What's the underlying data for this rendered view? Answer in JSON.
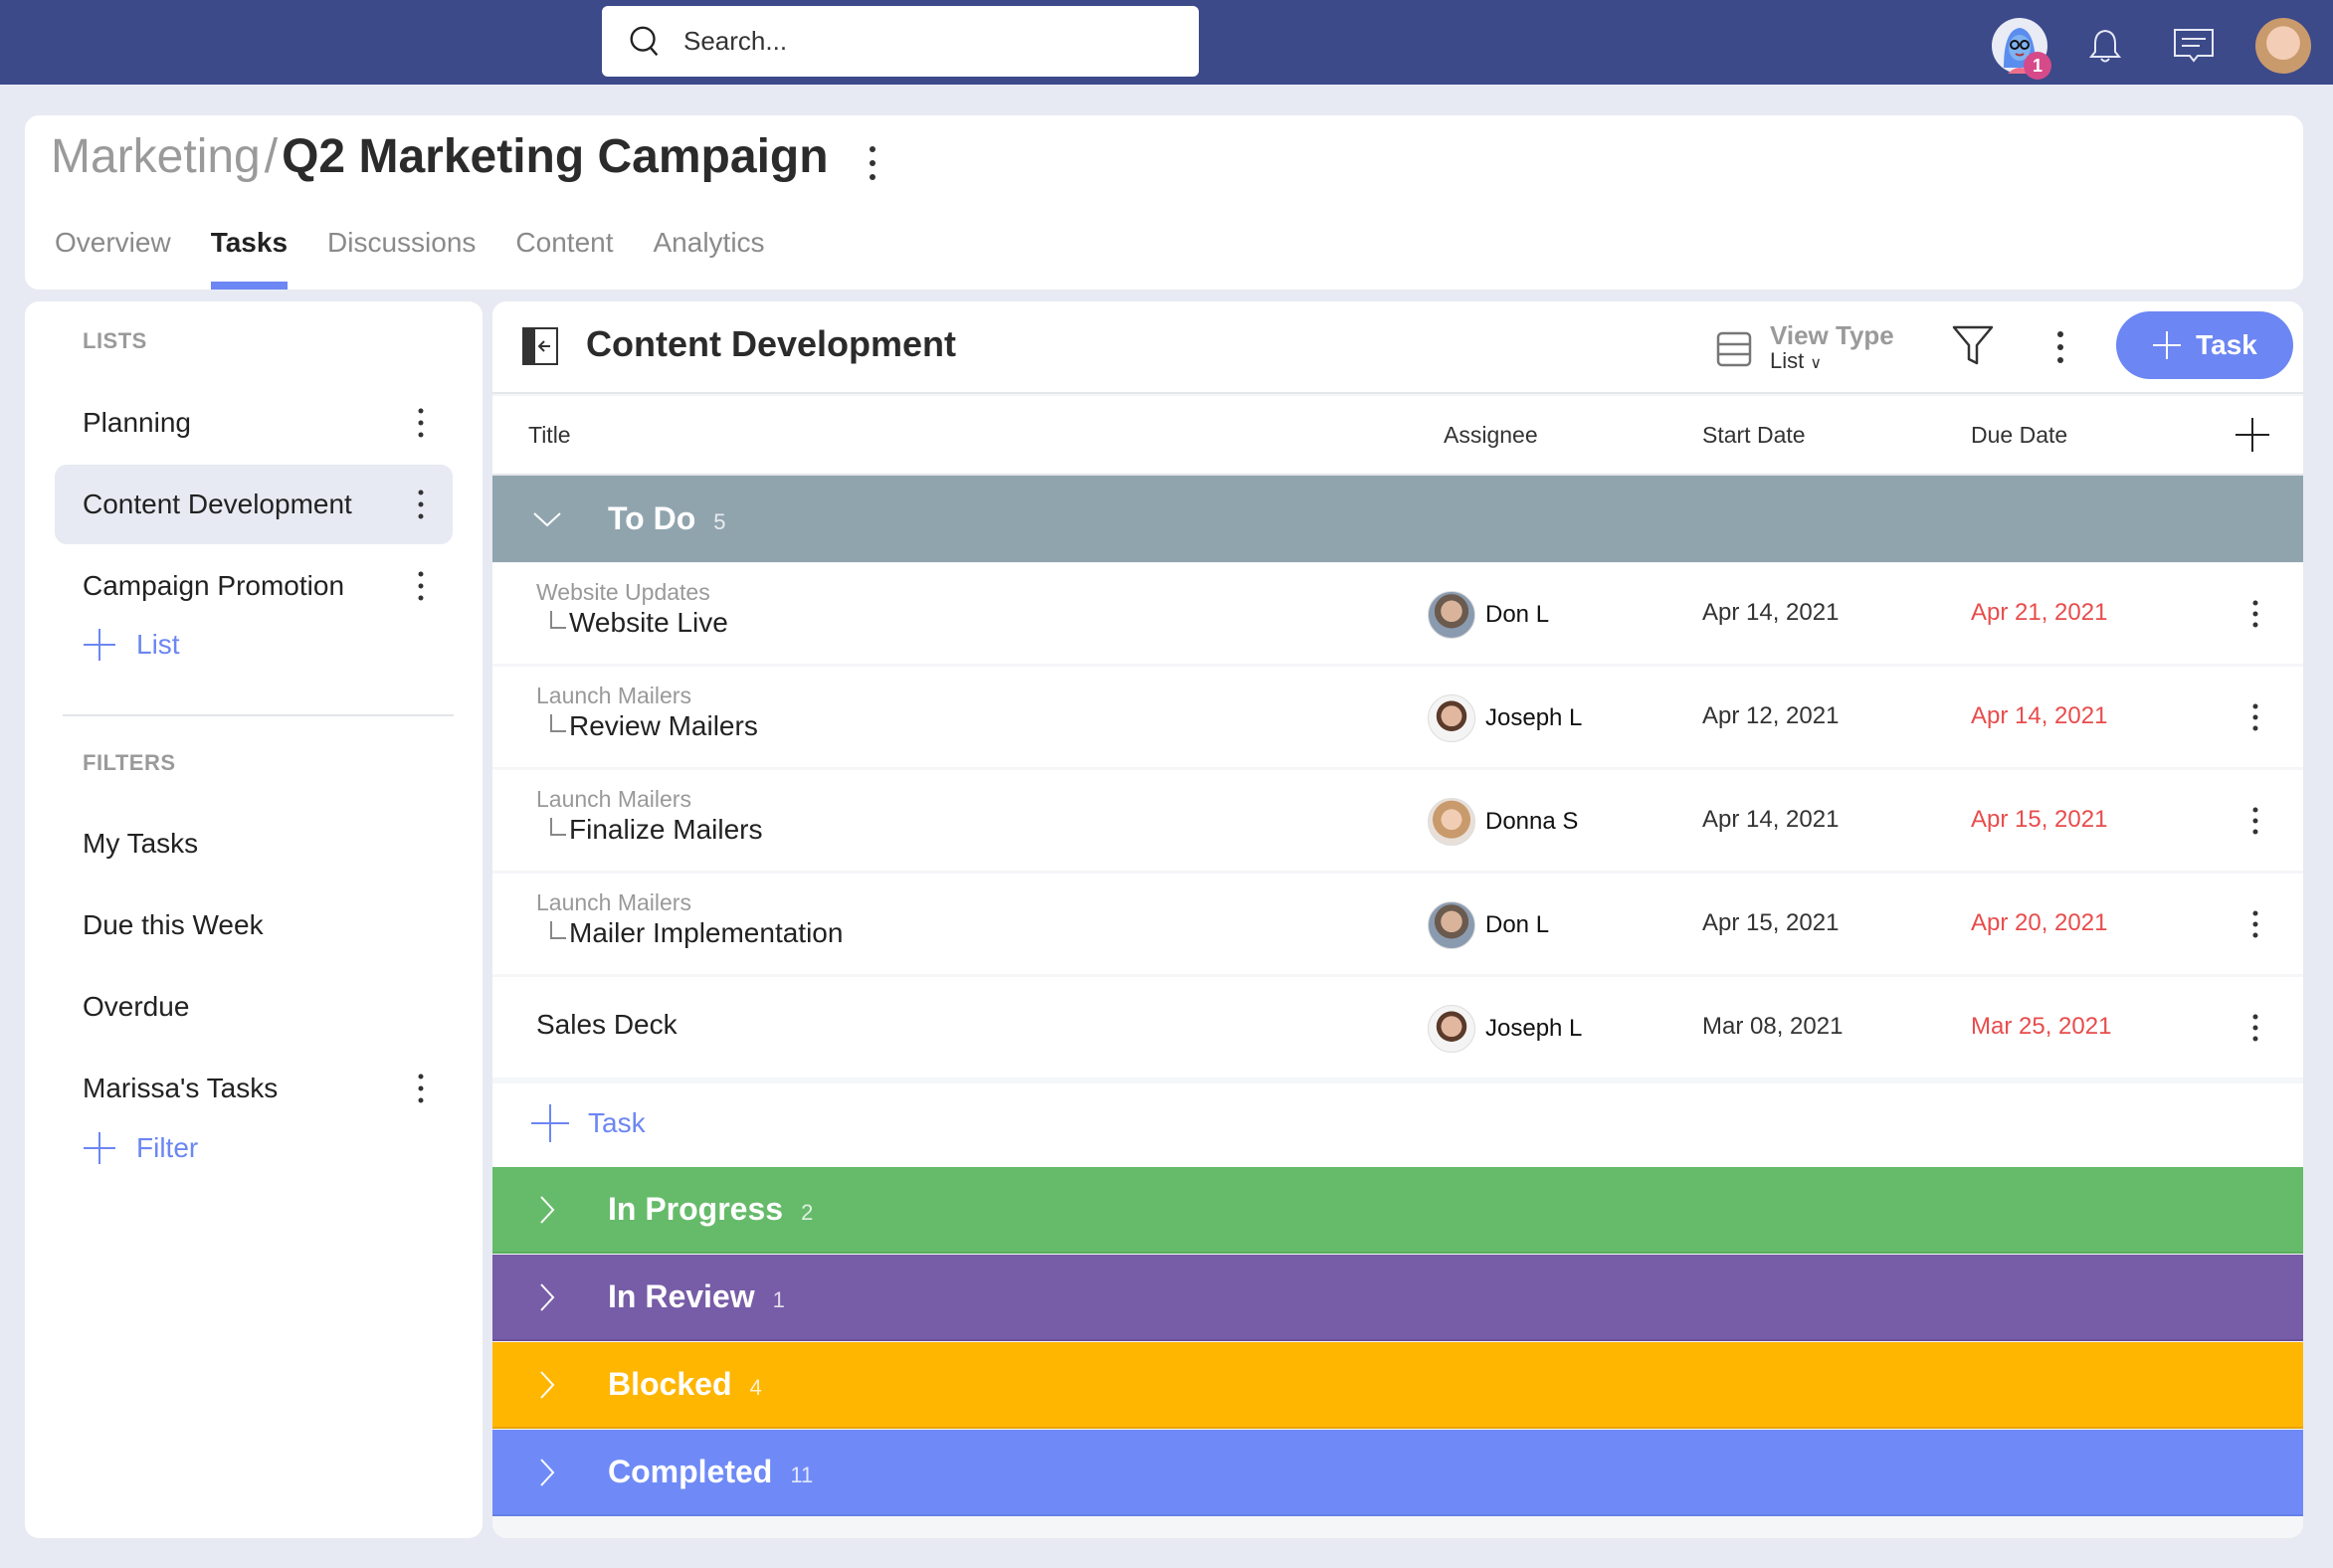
{
  "topbar": {
    "search_placeholder": "Search...",
    "notification_badge": "1",
    "icons": [
      "search-icon",
      "assistant-avatar",
      "bell-icon",
      "chat-icon",
      "user-avatar"
    ]
  },
  "header": {
    "breadcrumb_parent": "Marketing",
    "breadcrumb_separator": "/",
    "title": "Q2 Marketing Campaign",
    "tabs": [
      {
        "label": "Overview",
        "active": false
      },
      {
        "label": "Tasks",
        "active": true
      },
      {
        "label": "Discussions",
        "active": false
      },
      {
        "label": "Content",
        "active": false
      },
      {
        "label": "Analytics",
        "active": false
      }
    ]
  },
  "sidebar": {
    "lists_heading": "LISTS",
    "lists": [
      {
        "label": "Planning",
        "active": false
      },
      {
        "label": "Content Development",
        "active": true
      },
      {
        "label": "Campaign Promotion",
        "active": false
      }
    ],
    "add_list_label": "List",
    "filters_heading": "FILTERS",
    "filters": [
      {
        "label": "My Tasks"
      },
      {
        "label": "Due this Week"
      },
      {
        "label": "Overdue"
      },
      {
        "label": "Marissa's Tasks"
      }
    ],
    "add_filter_label": "Filter"
  },
  "main": {
    "list_title": "Content Development",
    "view_type_label": "View Type",
    "view_type_value": "List",
    "add_task_button": "Task",
    "columns": {
      "title": "Title",
      "assignee": "Assignee",
      "start_date": "Start Date",
      "due_date": "Due Date"
    },
    "groups": [
      {
        "name": "To Do",
        "count": "5",
        "color": "#90a4ae",
        "expanded": true
      },
      {
        "name": "In Progress",
        "count": "2",
        "color": "#66bb6a",
        "expanded": false
      },
      {
        "name": "In Review",
        "count": "1",
        "color": "#775ca7",
        "expanded": false
      },
      {
        "name": "Blocked",
        "count": "4",
        "color": "#ffb600",
        "expanded": false
      },
      {
        "name": "Completed",
        "count": "11",
        "color": "#6f8af6",
        "expanded": false
      }
    ],
    "tasks": [
      {
        "parent": "Website Updates",
        "title": "Website Live",
        "assignee": "Don L",
        "start": "Apr 14, 2021",
        "due": "Apr 21, 2021"
      },
      {
        "parent": "Launch Mailers",
        "title": "Review Mailers",
        "assignee": "Joseph L",
        "start": "Apr 12, 2021",
        "due": "Apr 14, 2021"
      },
      {
        "parent": "Launch Mailers",
        "title": "Finalize Mailers",
        "assignee": "Donna S",
        "start": "Apr 14, 2021",
        "due": "Apr 15, 2021"
      },
      {
        "parent": "Launch Mailers",
        "title": "Mailer Implementation",
        "assignee": "Don L",
        "start": "Apr 15, 2021",
        "due": "Apr 20, 2021"
      },
      {
        "parent": "",
        "title": "Sales Deck",
        "assignee": "Joseph L",
        "start": "Mar 08, 2021",
        "due": "Mar 25, 2021"
      }
    ],
    "add_task_link": "Task",
    "overdue_color": "#e84c4c",
    "accent_color": "#6c86f3"
  }
}
